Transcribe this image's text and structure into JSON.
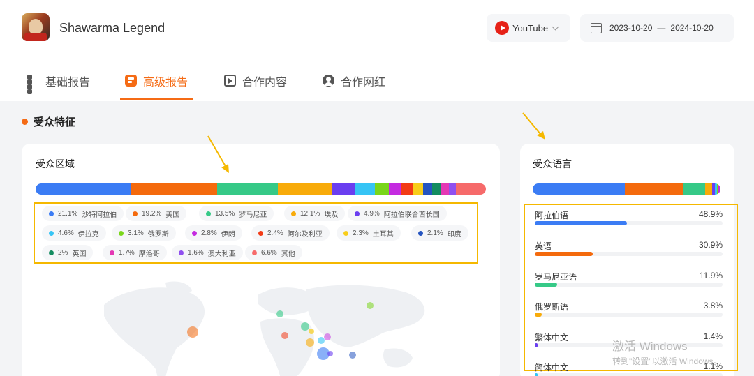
{
  "app": {
    "title": "Shawarma Legend"
  },
  "platform": {
    "label": "YouTube",
    "icon": "youtube-icon"
  },
  "date_range": {
    "start": "2023-10-20",
    "separator": "—",
    "end": "2024-10-20",
    "icon": "calendar-icon"
  },
  "tabs": [
    {
      "label": "基础报告",
      "icon": "grid-icon",
      "active": false
    },
    {
      "label": "高级报告",
      "icon": "advanced-report-icon",
      "active": true
    },
    {
      "label": "合作内容",
      "icon": "video-content-icon",
      "active": false
    },
    {
      "label": "合作网红",
      "icon": "user-icon",
      "active": false
    }
  ],
  "section": {
    "title": "受众特征",
    "accent": "#f56b15"
  },
  "region_card": {
    "title": "受众区域",
    "regions": [
      {
        "pct": "21.1%",
        "name": "沙特阿拉伯",
        "value": 21.1,
        "color": "#3b7cf4"
      },
      {
        "pct": "19.2%",
        "name": "美国",
        "value": 19.2,
        "color": "#f46a0d"
      },
      {
        "pct": "13.5%",
        "name": "罗马尼亚",
        "value": 13.5,
        "color": "#36c987"
      },
      {
        "pct": "12.1%",
        "name": "埃及",
        "value": 12.1,
        "color": "#f8ab0a"
      },
      {
        "pct": "4.9%",
        "name": "阿拉伯联合酋长国",
        "value": 4.9,
        "color": "#6a3ef0"
      },
      {
        "pct": "4.6%",
        "name": "伊拉克",
        "value": 4.6,
        "color": "#36c4f5"
      },
      {
        "pct": "3.1%",
        "name": "俄罗斯",
        "value": 3.1,
        "color": "#7ad61a"
      },
      {
        "pct": "2.8%",
        "name": "伊朗",
        "value": 2.8,
        "color": "#c42be0"
      },
      {
        "pct": "2.4%",
        "name": "阿尔及利亚",
        "value": 2.4,
        "color": "#f23b16"
      },
      {
        "pct": "2.3%",
        "name": "土耳其",
        "value": 2.3,
        "color": "#f8cd1a"
      },
      {
        "pct": "2.1%",
        "name": "印度",
        "value": 2.1,
        "color": "#2554c0"
      },
      {
        "pct": "2%",
        "name": "英国",
        "value": 2,
        "color": "#138c60"
      },
      {
        "pct": "1.7%",
        "name": "摩洛哥",
        "value": 1.7,
        "color": "#e438b4"
      },
      {
        "pct": "1.6%",
        "name": "澳大利亚",
        "value": 1.6,
        "color": "#9050ef"
      },
      {
        "pct": "6.6%",
        "name": "其他",
        "value": 6.6,
        "color": "#f66a6a"
      }
    ]
  },
  "language_card": {
    "title": "受众语言",
    "languages": [
      {
        "name": "阿拉伯语",
        "pct": "48.9%",
        "value": 48.9,
        "color": "#3b7cf4"
      },
      {
        "name": "英语",
        "pct": "30.9%",
        "value": 30.9,
        "color": "#f46a0d"
      },
      {
        "name": "罗马尼亚语",
        "pct": "11.9%",
        "value": 11.9,
        "color": "#36c987"
      },
      {
        "name": "俄罗斯语",
        "pct": "3.8%",
        "value": 3.8,
        "color": "#f8ab0a"
      },
      {
        "name": "繁体中文",
        "pct": "1.4%",
        "value": 1.4,
        "color": "#6a3ef0"
      },
      {
        "name": "简体中文",
        "pct": "1.1%",
        "value": 1.1,
        "color": "#36c4f5"
      }
    ],
    "bar_extra": [
      {
        "value": 1.0,
        "color": "#7ad61a"
      },
      {
        "value": 1.0,
        "color": "#c42be0"
      }
    ]
  },
  "watermark": {
    "title": "激活 Windows",
    "subtitle": "转到\"设置\"以激活 Windows。"
  }
}
